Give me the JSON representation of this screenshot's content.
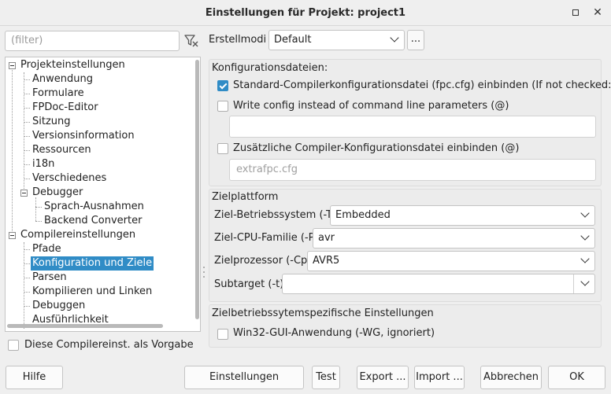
{
  "window": {
    "title": "Einstellungen für Projekt: project1"
  },
  "filter": {
    "placeholder": "(filter)"
  },
  "tree": {
    "items": [
      {
        "label": "Projekteinstellungen"
      },
      {
        "label": "Anwendung"
      },
      {
        "label": "Formulare"
      },
      {
        "label": "FPDoc-Editor"
      },
      {
        "label": "Sitzung"
      },
      {
        "label": "Versionsinformation"
      },
      {
        "label": "Ressourcen"
      },
      {
        "label": "i18n"
      },
      {
        "label": "Verschiedenes"
      },
      {
        "label": "Debugger"
      },
      {
        "label": "Sprach-Ausnahmen"
      },
      {
        "label": "Backend Converter"
      },
      {
        "label": "Compilereinstellungen"
      },
      {
        "label": "Pfade"
      },
      {
        "label": "Konfiguration und Ziele"
      },
      {
        "label": "Parsen"
      },
      {
        "label": "Kompilieren und Linken"
      },
      {
        "label": "Debuggen"
      },
      {
        "label": "Ausführlichkeit"
      }
    ],
    "selected": "Konfiguration und Ziele"
  },
  "default_checkbox": {
    "label": "Diese Compilereinst. als Vorgabe",
    "checked": false
  },
  "build_modes": {
    "label": "Erstellmodi",
    "value": "Default",
    "more_label": "..."
  },
  "config_files": {
    "title": "Konfigurationsdateien:",
    "std_config": {
      "label": "Standard-Compilerkonfigurationsdatei (fpc.cfg) einbinden (If not checked: -n)",
      "checked": true
    },
    "write_config": {
      "label": "Write config instead of command line parameters (@)",
      "checked": false
    },
    "write_config_value": "",
    "extra_config": {
      "label": "Zusätzliche Compiler-Konfigurationsdatei einbinden (@)",
      "checked": false
    },
    "extra_config_placeholder": "extrafpc.cfg"
  },
  "target_platform": {
    "title": "Zielplattform",
    "os": {
      "label": "Ziel-Betriebssystem (-T)",
      "value": "Embedded"
    },
    "cpu": {
      "label": "Ziel-CPU-Familie (-P)",
      "value": "avr"
    },
    "processor": {
      "label": "Zielprozessor (-Cp)",
      "value": "AVR5"
    },
    "subtarget": {
      "label": "Subtarget (-t)",
      "value": ""
    }
  },
  "target_specific": {
    "title": "Zielbetriebssytemspezifische Einstellungen",
    "win32_gui": {
      "label": "Win32-GUI-Anwendung (-WG, ignoriert)",
      "checked": false
    }
  },
  "buttons": {
    "help": "Hilfe",
    "show_options": "Einstellungen anzeigen",
    "test": "Test",
    "export": "Export ...",
    "import": "Import ...",
    "cancel": "Abbrechen",
    "ok": "OK"
  },
  "icons": {
    "filter_clear": "filter-clear-icon",
    "maximize": "maximize-icon",
    "close": "close-icon",
    "dropdown": "chevron-down-icon"
  },
  "colors": {
    "accent": "#308cc6",
    "background": "#efefef"
  }
}
